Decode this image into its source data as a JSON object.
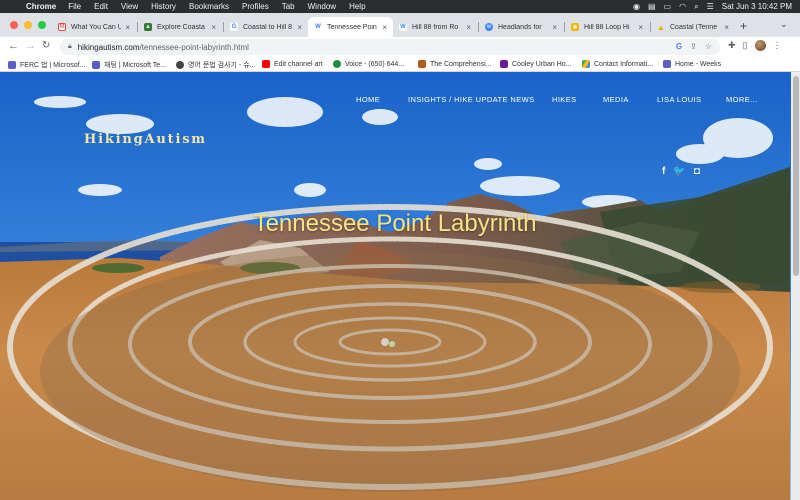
{
  "menubar": {
    "app": "Chrome",
    "items": [
      "File",
      "Edit",
      "View",
      "History",
      "Bookmarks",
      "Profiles",
      "Tab",
      "Window",
      "Help"
    ],
    "datetime": "Sat Jun 3  10:42 PM"
  },
  "tabs": [
    {
      "title": "What You Can U",
      "icon": "gmail-icon",
      "color": "#ea4335"
    },
    {
      "title": "Explore Coasta",
      "icon": "alltrails-icon",
      "color": "#2e7d32"
    },
    {
      "title": "Coastal to Hill 8",
      "icon": "google-icon",
      "color": "#4285f4"
    },
    {
      "title": "Tennessee Poin",
      "icon": "wix-icon",
      "color": "#3b82f6",
      "active": true
    },
    {
      "title": "Hill 88 from Ro",
      "icon": "wix-icon",
      "color": "#3b82f6"
    },
    {
      "title": "Headlands for",
      "icon": "wordpress-icon",
      "color": "#3b82f6"
    },
    {
      "title": "Hill 88 Loop Hi",
      "icon": "star-icon",
      "color": "#f5b400"
    },
    {
      "title": "Coastal (Tenne",
      "icon": "warning-icon",
      "color": "#f2a900"
    }
  ],
  "toolbar": {
    "url_host": "hikingautism.com",
    "url_path": "/tennessee-point-labyrinth.html"
  },
  "bookmarks": [
    {
      "label": "FERC 법 | Microsof...",
      "color": "#5b5fc7"
    },
    {
      "label": "채팅 | Microsoft Te...",
      "color": "#5b5fc7"
    },
    {
      "label": "영어 문법 검사기 - 슈...",
      "color": "#444444"
    },
    {
      "label": "Edit channel art",
      "color": "#ff0000"
    },
    {
      "label": "Voice - (650) 644...",
      "color": "#1e8e3e"
    },
    {
      "label": "The Comprehensi...",
      "color": "#b35c1e"
    },
    {
      "label": "Cooley Urban Ho...",
      "color": "#6a1b9a"
    },
    {
      "label": "Contact Informati...",
      "color": "#34a853"
    },
    {
      "label": "Home - Weeks",
      "color": "#5b5fc7"
    }
  ],
  "site": {
    "logo": "HikingAutism",
    "nav": [
      "HOME",
      "INSIGHTS / HIKE UPDATE NEWS",
      "HIKES",
      "MEDIA",
      "LISA LOUIS",
      "MORE..."
    ],
    "social": [
      "f",
      "🐦",
      "◘"
    ],
    "hero_title": "Tennessee Point Labyrinth"
  }
}
